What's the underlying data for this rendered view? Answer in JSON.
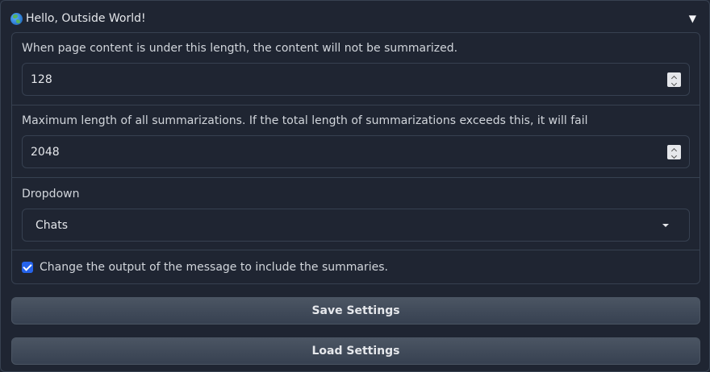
{
  "accordion": {
    "title": "Hello, Outside World!",
    "icon": "globe-icon",
    "expanded": true
  },
  "min_length": {
    "label": "When page content is under this length, the content will not be summarized.",
    "value": "128"
  },
  "max_length": {
    "label": "Maximum length of all summarizations. If the total length of summarizations exceeds this, it will fail",
    "value": "2048"
  },
  "dropdown": {
    "label": "Dropdown",
    "selected": "Chats"
  },
  "checkbox": {
    "label": "Change the output of the message to include the summaries.",
    "checked": true
  },
  "buttons": {
    "save": "Save Settings",
    "load": "Load Settings"
  },
  "colors": {
    "background": "#1f2532",
    "border": "#374151",
    "accent": "#2563eb"
  }
}
